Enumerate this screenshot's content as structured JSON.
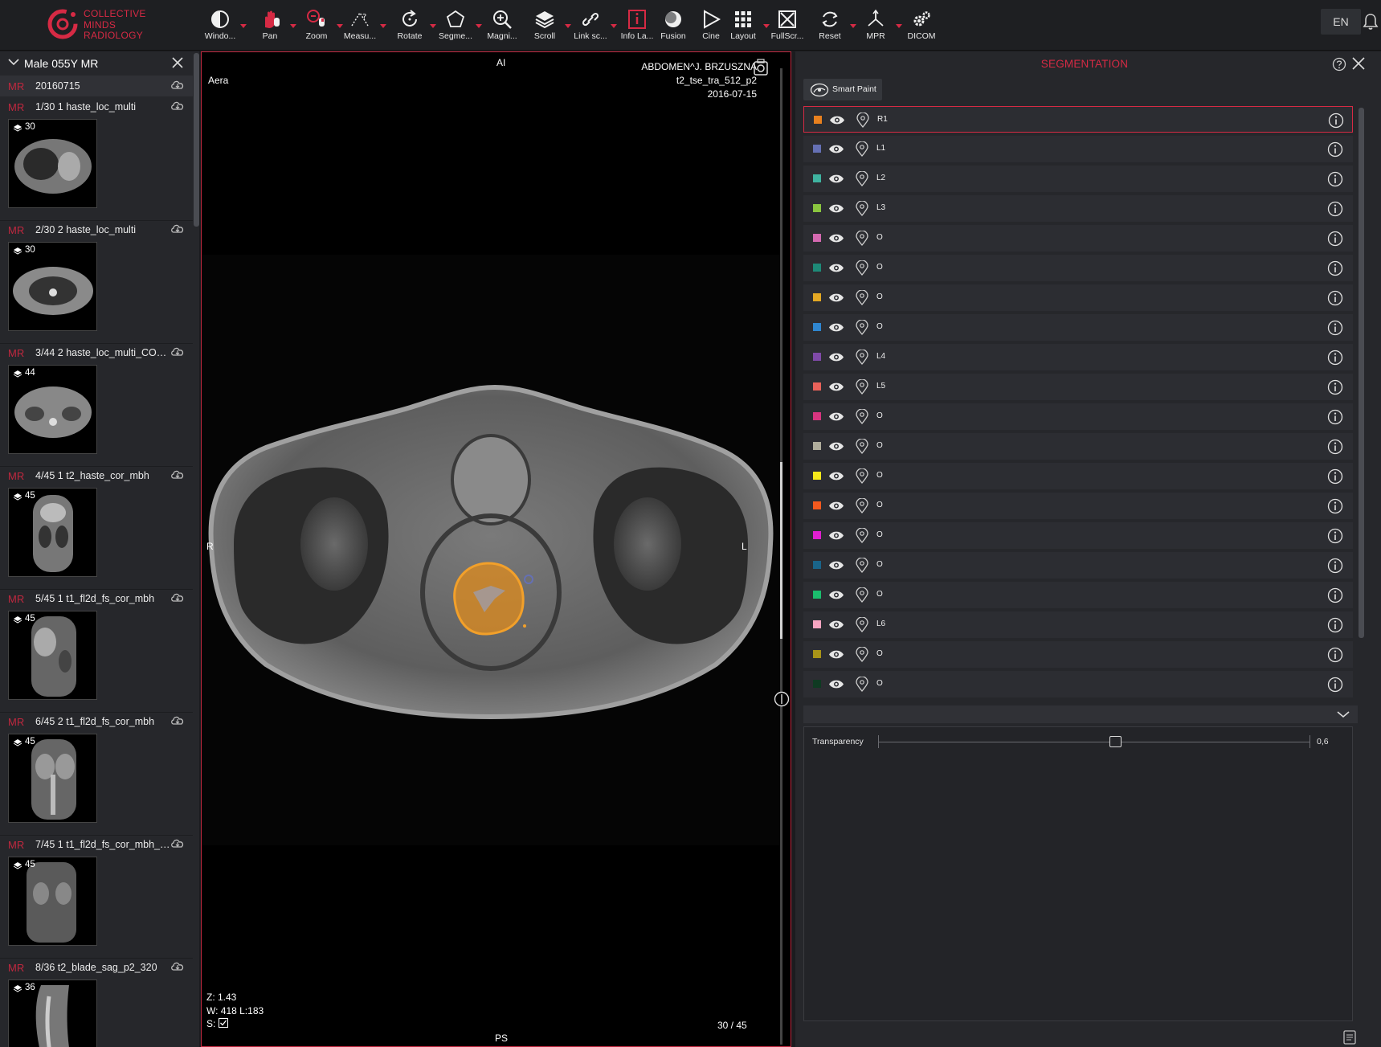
{
  "app": {
    "logo_line1": "COLLECTIVE",
    "logo_line2": "MINDS",
    "logo_line3": "RADIOLOGY",
    "accent_color": "#d62a44"
  },
  "toolbar": {
    "tools": [
      {
        "id": "window",
        "label": "Windo...",
        "icon": "window-level-icon",
        "caret": true
      },
      {
        "id": "pan",
        "label": "Pan",
        "icon": "hand-icon",
        "caret": true
      },
      {
        "id": "zoom",
        "label": "Zoom",
        "icon": "zoom-mouse-icon",
        "caret": true
      },
      {
        "id": "measure",
        "label": "Measu...",
        "icon": "measure-icon",
        "caret": true
      },
      {
        "id": "rotate",
        "label": "Rotate",
        "icon": "rotate-icon",
        "caret": true
      },
      {
        "id": "segment",
        "label": "Segme...",
        "icon": "pentagon-icon",
        "caret": true
      },
      {
        "id": "magnify",
        "label": "Magni...",
        "icon": "magnifier-icon",
        "caret": false
      },
      {
        "id": "scroll",
        "label": "Scroll",
        "icon": "layers-icon",
        "caret": true
      },
      {
        "id": "link",
        "label": "Link sc...",
        "icon": "link-icon",
        "caret": true
      },
      {
        "id": "info",
        "label": "Info La...",
        "icon": "info-layer-icon",
        "caret": false
      },
      {
        "id": "fusion",
        "label": "Fusion",
        "icon": "fusion-icon",
        "caret": false
      },
      {
        "id": "cine",
        "label": "Cine",
        "icon": "play-icon",
        "caret": false
      },
      {
        "id": "layout",
        "label": "Layout",
        "icon": "grid-icon",
        "caret": true
      },
      {
        "id": "fullscreen",
        "label": "FullScr...",
        "icon": "fullscreen-icon",
        "caret": false
      },
      {
        "id": "reset",
        "label": "Reset",
        "icon": "reset-icon",
        "caret": true
      },
      {
        "id": "mpr",
        "label": "MPR",
        "icon": "axes-icon",
        "caret": true
      },
      {
        "id": "dicom",
        "label": "DICOM",
        "icon": "gears-icon",
        "caret": false
      }
    ],
    "language": "EN"
  },
  "series_panel": {
    "patient": "Male 055Y MR",
    "study": {
      "modality": "MR",
      "date": "20160715"
    },
    "series": [
      {
        "modality": "MR",
        "desc": "1/30 1 haste_loc_multi",
        "count": "30"
      },
      {
        "modality": "MR",
        "desc": "2/30 2 haste_loc_multi",
        "count": "30"
      },
      {
        "modality": "MR",
        "desc": "3/44 2 haste_loc_multi_COMP...",
        "count": "44"
      },
      {
        "modality": "MR",
        "desc": "4/45 1 t2_haste_cor_mbh",
        "count": "45"
      },
      {
        "modality": "MR",
        "desc": "5/45 1 t1_fl2d_fs_cor_mbh",
        "count": "45"
      },
      {
        "modality": "MR",
        "desc": "6/45 2 t1_fl2d_fs_cor_mbh",
        "count": "45"
      },
      {
        "modality": "MR",
        "desc": "7/45 1 t1_fl2d_fs_cor_mbh_CO...",
        "count": "45"
      },
      {
        "modality": "MR",
        "desc": "8/36 t2_blade_sag_p2_320",
        "count": "36"
      }
    ]
  },
  "viewer": {
    "orient_top": "AI",
    "orient_bottom": "PS",
    "orient_left": "R",
    "orient_right": "L",
    "manufacturer": "Aera",
    "study_desc": "ABDOMEN^J. BRZUSZNA",
    "series_desc": "t2_tse_tra_512_p2",
    "date": "2016-07-15",
    "zoom": "Z: 1.43",
    "window": "W: 418 L:183",
    "sync_label": "S:",
    "slice": "30 / 45"
  },
  "segmentation": {
    "title": "SEGMENTATION",
    "smart_paint": "Smart Paint",
    "segments": [
      {
        "name": "R1",
        "color": "#e8801e",
        "selected": true
      },
      {
        "name": "L1",
        "color": "#6570b4"
      },
      {
        "name": "L2",
        "color": "#3fb3a0"
      },
      {
        "name": "L3",
        "color": "#8ac53f"
      },
      {
        "name": "O",
        "color": "#d469b0"
      },
      {
        "name": "O",
        "color": "#1e8a78"
      },
      {
        "name": "O",
        "color": "#e3a824"
      },
      {
        "name": "O",
        "color": "#2f86d0"
      },
      {
        "name": "L4",
        "color": "#7f4aa8"
      },
      {
        "name": "L5",
        "color": "#e8625a"
      },
      {
        "name": "O",
        "color": "#d7357f"
      },
      {
        "name": "O",
        "color": "#b0ad9c"
      },
      {
        "name": "O",
        "color": "#f4e81b"
      },
      {
        "name": "O",
        "color": "#f2591e"
      },
      {
        "name": "O",
        "color": "#df1fcf"
      },
      {
        "name": "O",
        "color": "#1a6489"
      },
      {
        "name": "O",
        "color": "#1bbd6d"
      },
      {
        "name": "L6",
        "color": "#f6a5c1"
      },
      {
        "name": "O",
        "color": "#a89418"
      },
      {
        "name": "O",
        "color": "#0f3a22"
      }
    ],
    "transparency_label": "Transparency",
    "transparency_value": "0,6",
    "transparency_fraction": 0.55
  }
}
